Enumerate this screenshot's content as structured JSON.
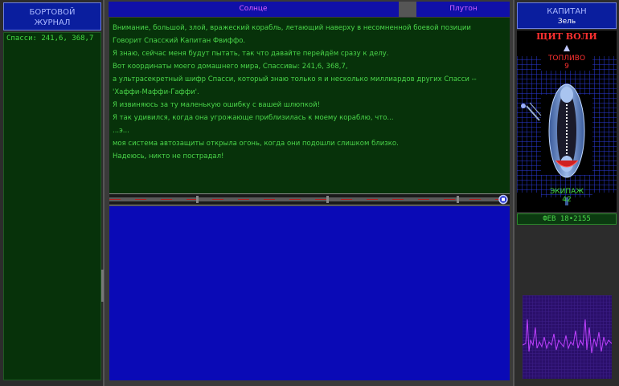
{
  "log": {
    "header_line1": "БОРТОВОЙ",
    "header_line2": "ЖУРНАЛ",
    "entry": "Спасси: 241,6, 368,7"
  },
  "tabs": {
    "left": "Солнце",
    "right": "Плутон"
  },
  "message_lines": [
    "Внимание, большой, злой, вражеский корабль, летающий наверху в несомненной боевой позиции",
    "Говорит Спасский Капитан Фвиффо.",
    "Я знаю, сейчас меня будут пытать, так что давайте перейдём сразу к делу.",
    "Вот координаты моего домашнего мира, Спассивы: 241,6, 368,7,",
    "а ультрасекретный шифр Спасси, который знаю только я и несколько миллиардов других Спасси --",
    "'Хаффи-Маффи-Гаффи'.",
    "Я извиняюсь за ту маленькую ошибку с вашей шлюпкой!",
    "Я так удивился, когда она угрожающе приблизилась к моему кораблю, что...",
    "...э...",
    "моя система автозащиты открыла огонь, когда они подошли слишком близко.",
    "Надеюсь, никто не пострадал!"
  ],
  "captain": {
    "title": "КАПИТАН",
    "name": "Зель"
  },
  "ship": {
    "shield_label": "ЩИТ ВОЛИ",
    "fuel_label": "ТОПЛИВО",
    "fuel_value": "9",
    "crew_label": "ЭКИПАЖ",
    "crew_value": "42"
  },
  "stardate": "ФЕВ 18•2155",
  "colors": {
    "panel_blue": "#0a1e9e",
    "text_green": "#4ad64a",
    "tab_magenta": "#e060ff",
    "ship_title_red": "#ff3030"
  }
}
